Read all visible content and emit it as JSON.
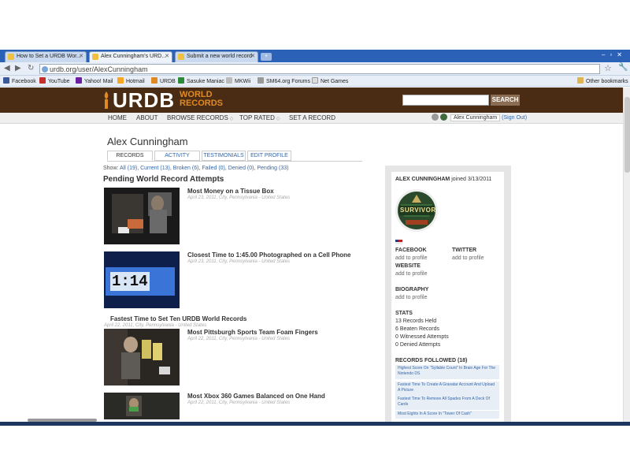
{
  "browser": {
    "tabs": [
      {
        "title": "How to Set a URDB Wor..."
      },
      {
        "title": "Alex Cunningham's URD..."
      },
      {
        "title": "Submit a new world record"
      }
    ],
    "url": "urdb.org/user/AlexCunningham",
    "bookmarks": [
      "Facebook",
      "YouTube",
      "Yahoo! Mail",
      "Hotmail",
      "URDB",
      "Sasuke Maniac",
      "MKWii",
      "SM64.org Forums",
      "Net Games"
    ],
    "other_bookmarks": "Other bookmarks"
  },
  "site": {
    "logo": "URDB",
    "logo_sub_1": "WORLD",
    "logo_sub_2": "RECORDS",
    "search_button": "SEARCH",
    "nav": [
      "HOME",
      "ABOUT",
      "BROWSE RECORDS",
      "TOP RATED",
      "SET A RECORD"
    ],
    "user_name": "Alex Cunningham",
    "sign_out": "(Sign Out)"
  },
  "profile": {
    "name": "Alex Cunningham",
    "tabs": [
      "RECORDS",
      "ACTIVITY",
      "TESTIMONIALS",
      "EDIT PROFILE"
    ],
    "show_label": "Show:",
    "filters": [
      "All (19)",
      "Current (13)",
      "Broken (6)",
      "Failed (0)",
      "Denied (0)",
      "Pending (33)"
    ],
    "pending_title": "Pending World Record Attempts",
    "records": [
      {
        "title": "Most Money on a Tissue Box",
        "meta": "April 23, 2011, City, Pennsylvania - United States"
      },
      {
        "title": "Closest Time to 1:45.00 Photographed on a Cell Phone",
        "meta": "April 23, 2011, City, Pennsylvania - United States",
        "thumb_text": "1:14"
      },
      {
        "title": "Fastest Time to Set Ten URDB World Records",
        "meta": "April 22, 2011, City, Pennsylvania - United States"
      },
      {
        "title": "Most Pittsburgh Sports Team Foam Fingers",
        "meta": "April 22, 2011, City, Pennsylvania - United States"
      },
      {
        "title": "Most Xbox 360 Games Balanced on One Hand",
        "meta": "April 22, 2011, City, Pennsylvania - United States"
      }
    ]
  },
  "sidebar": {
    "header_name": "ALEX CUNNINGHAM",
    "header_joined": "joined 3/13/2011",
    "badge_text": "SURVIVOR",
    "facebook_label": "FACEBOOK",
    "facebook_value": "add to profile",
    "twitter_label": "TWITTER",
    "twitter_value": "add to profile",
    "website_label": "WEBSITE",
    "website_value": "add to profile",
    "biography_label": "BIOGRAPHY",
    "biography_value": "add to profile",
    "stats_label": "STATS",
    "stats": [
      "13 Records Held",
      "6 Beaten Records",
      "0 Witnessed Attempts",
      "0 Denied Attempts"
    ],
    "followed_label": "RECORDS FOLLOWED (18)",
    "followed": [
      "Highest Score On \"Syllable Count\" In Brain Age For The Nintendo DS",
      "Fastest Time To Create A Gravatar Account And Upload A Picture",
      "Fastest Time To Remove All Spades From A Deck Of Cards",
      "Most Eights In A Score In \"Tower Of Cash\""
    ]
  },
  "colors": {
    "header_bg": "#4a2c14",
    "accent_orange": "#e08a24",
    "link_blue": "#3366aa"
  }
}
